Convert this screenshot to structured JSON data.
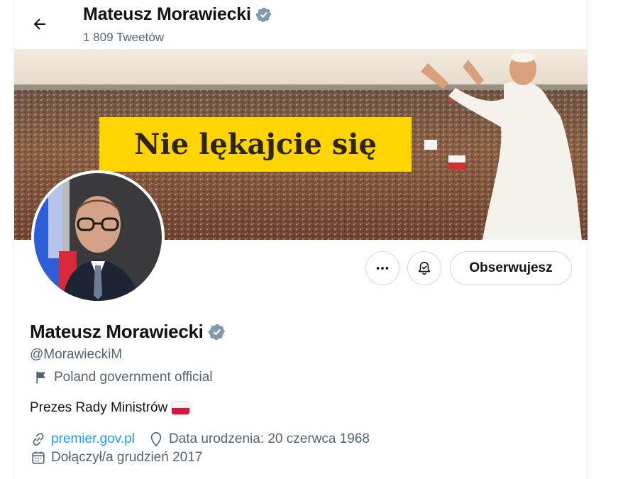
{
  "header": {
    "name": "Mateusz Morawiecki",
    "tweet_count": "1 809 Tweetów"
  },
  "banner": {
    "slogan": "Nie lękajcie się"
  },
  "actions": {
    "follow_label": "Obserwujesz"
  },
  "profile": {
    "name": "Mateusz Morawiecki",
    "handle": "@MorawieckiM",
    "label": "Poland government official",
    "bio": "Prezes Rady Ministrów",
    "website": "premier.gov.pl",
    "birthday": "Data urodzenia: 20 czerwca 1968",
    "joined": "Dołączył/a grudzień 2017"
  },
  "colors": {
    "accent": "#1d9bf0",
    "verified_badge": "#829aab",
    "secondary_text": "#536471",
    "banner_slogan_bg": "#ffd500"
  },
  "icons": [
    "back-arrow-icon",
    "verified-badge-icon",
    "more-icon",
    "bell-subscribed-icon",
    "flag-icon",
    "link-icon",
    "location-pin-icon",
    "calendar-icon"
  ]
}
